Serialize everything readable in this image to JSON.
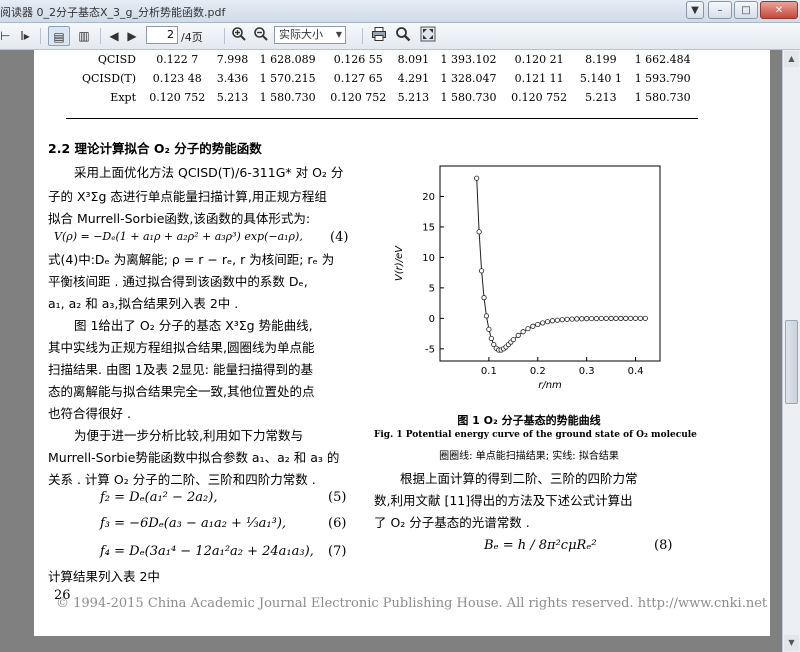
{
  "window": {
    "title": "阅读器  0_2分子基态X_3_g_分析势能函数.pdf"
  },
  "toolbar": {
    "current_page": "2",
    "page_total": "/4页",
    "zoom": "实际大小",
    "icons": [
      "text-select-icon",
      "single-page-icon",
      "two-page-icon",
      "prev-page-icon",
      "next-page-icon",
      "zoom-in-icon",
      "zoom-out-icon",
      "print-icon",
      "find-icon",
      "fullscreen-icon"
    ]
  },
  "table": {
    "rows": [
      {
        "label": "QCISD",
        "cells": [
          "0.122 7",
          "7.998",
          "1 628.089",
          "0.126 55",
          "8.091",
          "1 393.102",
          "0.120 21",
          "8.199",
          "1 662.484"
        ]
      },
      {
        "label": "QCISD(T)",
        "cells": [
          "0.123 48",
          "3.436",
          "1 570.215",
          "0.127 65",
          "4.291",
          "1 328.047",
          "0.121 11",
          "5.140 1",
          "1 593.790"
        ]
      },
      {
        "label": "Expt",
        "cells": [
          "0.120 752",
          "5.213",
          "1 580.730",
          "0.120 752",
          "5.213",
          "1 580.730",
          "0.120 752",
          "5.213",
          "1 580.730"
        ]
      }
    ]
  },
  "section": {
    "heading": "2.2  理论计算拟合 O₂ 分子的势能函数"
  },
  "left_text": {
    "p1_l1": "采用上面优化方法 QCISD(T)/6-311G* 对 O₂ 分",
    "p1_l2": "子的 X³Σg 态进行单点能量扫描计算,用正规方程组",
    "p1_l3": "拟合 Murrell-Sorbie函数,该函数的具体形式为:",
    "eq4": "V(ρ) = −Dₑ(1 + a₁ρ + a₂ρ² + a₃ρ³) exp(−a₁ρ),",
    "eq4_no": "(4)",
    "p2_l1": "式(4)中:Dₑ 为离解能; ρ = r − rₑ, r 为核间距; rₑ 为",
    "p2_l2": "平衡核间距 . 通过拟合得到该函数中的系数 Dₑ,",
    "p2_l3": "a₁, a₂ 和 a₃,拟合结果列入表 2中 .",
    "p3_l1": "图 1给出了 O₂ 分子的基态 X³Σg 势能曲线,",
    "p3_l2": "其中实线为正规方程组拟合结果,圆圈线为单点能",
    "p3_l3": "扫描结果. 由图 1及表 2显见: 能量扫描得到的基",
    "p3_l4": "态的离解能与拟合结果完全一致,其他位置处的点",
    "p3_l5": "也符合得很好 .",
    "p4_l1": "为便于进一步分析比较,利用如下力常数与",
    "p4_l2": "Murrell-Sorbie势能函数中拟合参数 a₁、a₂ 和 a₃ 的",
    "p4_l3": "关系 . 计算 O₂ 分子的二阶、三阶和四阶力常数 .",
    "eq5": "f₂ = Dₑ(a₁² − 2a₂),",
    "eq5_no": "(5)",
    "eq6": "f₃ = −6Dₑ(a₃ − a₁a₂ + ⅓a₁³),",
    "eq6_no": "(6)",
    "eq7": "f₄ = Dₑ(3a₁⁴ − 12a₁²a₂ + 24a₁a₃),",
    "eq7_no": "(7)",
    "p5_l1": "计算结果列入表 2中"
  },
  "figure": {
    "caption_cn": "图 1   O₂ 分子基态的势能曲线",
    "caption_en": "Fig. 1 Potential energy curve of the ground state of O₂ molecule",
    "caption_note": "圈圈线: 单点能扫描结果; 实线: 拟合结果"
  },
  "right_text": {
    "p1_l1": "根据上面计算的得到二阶、三阶的四阶力常",
    "p1_l2": "数,利用文献 [11]得出的方法及下述公式计算出",
    "p1_l3": "了 O₂ 分子基态的光谱常数 .",
    "eq8": "Bₑ = h / 8π²cμRₑ²",
    "eq8_no": "(8)"
  },
  "footer": {
    "page_number": "26",
    "watermark": "© 1994-2015 China Academic Journal Electronic Publishing House. All rights reserved.    http://www.cnki.net"
  },
  "chart_data": {
    "type": "scatter",
    "title": "",
    "xlabel": "r/nm",
    "ylabel": "V(r)/eV",
    "xlim": [
      0.0,
      0.45
    ],
    "ylim": [
      -7,
      25
    ],
    "xticks": [
      "0.1",
      "0.2",
      "0.3",
      "0.4"
    ],
    "yticks": [
      "-5",
      "0",
      "5",
      "10",
      "15",
      "20"
    ],
    "series": [
      {
        "kind": "line-with-circles",
        "x": [
          0.075,
          0.08,
          0.085,
          0.09,
          0.095,
          0.1,
          0.105,
          0.11,
          0.115,
          0.12,
          0.125,
          0.13,
          0.135,
          0.14,
          0.145,
          0.15,
          0.16,
          0.17,
          0.18,
          0.19,
          0.2,
          0.21,
          0.22,
          0.23,
          0.24,
          0.25,
          0.26,
          0.27,
          0.28,
          0.29,
          0.3,
          0.31,
          0.32,
          0.33,
          0.34,
          0.35,
          0.36,
          0.37,
          0.38,
          0.39,
          0.4,
          0.41,
          0.42
        ],
        "y": [
          23.0,
          14.2,
          7.8,
          3.4,
          0.4,
          -1.8,
          -3.3,
          -4.3,
          -4.9,
          -5.2,
          -5.2,
          -5.0,
          -4.7,
          -4.3,
          -3.9,
          -3.5,
          -2.8,
          -2.2,
          -1.7,
          -1.3,
          -1.0,
          -0.75,
          -0.55,
          -0.4,
          -0.3,
          -0.22,
          -0.16,
          -0.12,
          -0.09,
          -0.07,
          -0.05,
          -0.04,
          -0.03,
          -0.02,
          -0.015,
          -0.01,
          -0.01,
          -0.005,
          -0.005,
          0,
          0,
          0,
          0
        ]
      }
    ]
  }
}
